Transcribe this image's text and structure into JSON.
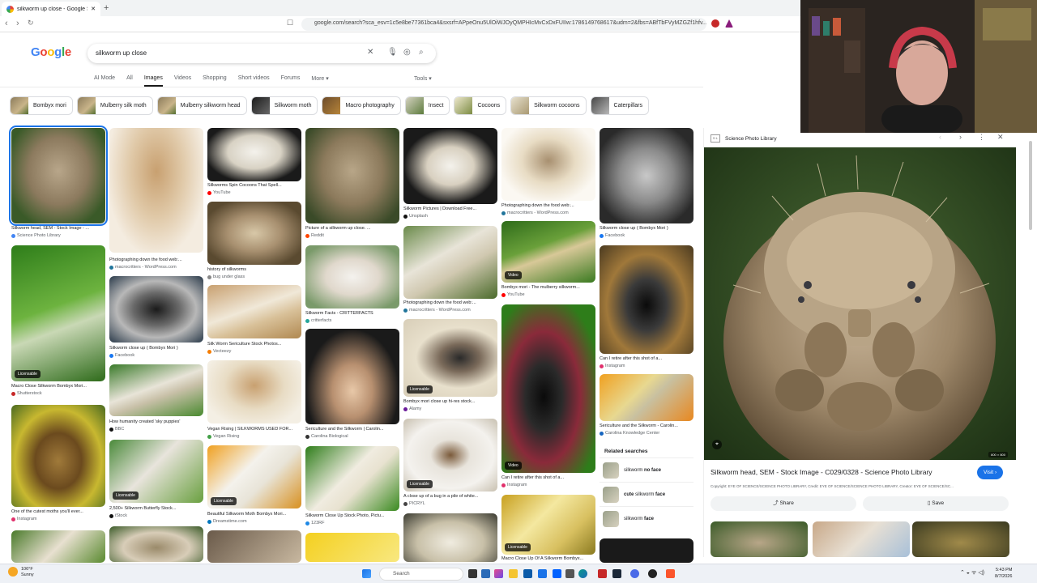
{
  "browser": {
    "tab_title": "silkworm up close - Google Sear",
    "url": "google.com/search?sca_esv=1c5e8be77361bca4&sxsrf=APpeOnu5UlOiWJOyQMPHIcMvCxDxFUIIw:1786149768617&udm=2&fbs=ABfTbFVyMZGZf1hfv..."
  },
  "google": {
    "logo": "Google",
    "query": "silkworm up close",
    "tabs": [
      "AI Mode",
      "All",
      "Images",
      "Videos",
      "Shopping",
      "Short videos",
      "Forums",
      "More ▾"
    ],
    "active_tab": "Images",
    "tools": "Tools ▾"
  },
  "chips": [
    "Bombyx mori",
    "Mulberry silk moth",
    "Mulberry silkworm head",
    "Silkworm moth",
    "Macro photography",
    "Insect",
    "Cocoons",
    "Silkworm cocoons",
    "Caterpillars"
  ],
  "results": [
    {
      "cap": "Silkworm head, SEM - Stock Image - ...",
      "src": "Science Photo Library"
    },
    {
      "cap": "Macro Close Silkworm Bombyx Mori...",
      "src": "Shutterstock",
      "badge": "Licensable"
    },
    {
      "cap": "One of the cutest moths you'll ever...",
      "src": "Instagram"
    },
    {
      "cap": "Photographing down the food web:...",
      "src": "macrocritters - WordPress.com"
    },
    {
      "cap": "Silkworm close up ( Bombyx Mori )",
      "src": "Facebook"
    },
    {
      "cap": "How humanity created 'sky puppies'",
      "src": "BBC"
    },
    {
      "cap": "2,500+ Silkworm Butterfly Stock...",
      "src": "iStock",
      "badge": "Licensable"
    },
    {
      "cap": "Silkworms Spin Cocoons That Spell...",
      "src": "YouTube"
    },
    {
      "cap": "history of silkworms",
      "src": "bug under glass"
    },
    {
      "cap": "Silk Worm Sericulture Stock Photos...",
      "src": "Vecteezy"
    },
    {
      "cap": "Vegan Rising | SILKWORMS USED FOR...",
      "src": "Vegan Rising"
    },
    {
      "cap": "Beautiful Silkworm Moth Bombyx Mori...",
      "src": "Dreamstime.com",
      "badge": "Licensable"
    },
    {
      "cap": "Picture of a silkworm up close. ...",
      "src": "Reddit"
    },
    {
      "cap": "Silkworm Facts - CRITTERFACTS",
      "src": "critterfacts"
    },
    {
      "cap": "Sericulture and the Silkworm | Carolin...",
      "src": "Carolina Biological"
    },
    {
      "cap": "Silkworm Close Up Stock Photo, Pictu...",
      "src": "123RF"
    },
    {
      "cap": "Silkworm Pictures | Download Free...",
      "src": "Unsplash"
    },
    {
      "cap": "Photographing down the food web:...",
      "src": "macrocritters - WordPress.com"
    },
    {
      "cap": "Bombyx mori close up hi-res stock...",
      "src": "Alamy",
      "badge": "Licensable"
    },
    {
      "cap": "A close up of a bug in a pile of white...",
      "src": "PICRYL",
      "badge": "Licensable"
    },
    {
      "cap": "Photographing down the food web:...",
      "src": "macrocritters - WordPress.com"
    },
    {
      "cap": "Bombyx mori - The mulberry silkworm...",
      "src": "YouTube",
      "badge": "Video"
    },
    {
      "cap": "Can I retire after this shot of a...",
      "src": "Instagram",
      "badge": "Video"
    },
    {
      "cap": "Macro Close Up Of A Silkworm Bombyx...",
      "src": "",
      "badge": "Licensable"
    },
    {
      "cap": "Silkworm close up ( Bombyx Mori )",
      "src": "Facebook"
    },
    {
      "cap": "Can I retire after this shot of a...",
      "src": "Instagram"
    },
    {
      "cap": "Sericulture and the Silkworm - Carolin...",
      "src": "Carolina Knowledge Center"
    }
  ],
  "related": {
    "heading": "Related searches",
    "items": [
      {
        "pre": "silkworm ",
        "bold": "no face"
      },
      {
        "pre": "",
        "bold": "cute ",
        "post": "silkworm ",
        "bold2": "face"
      },
      {
        "pre": "silkworm ",
        "bold": "face"
      }
    ]
  },
  "panel": {
    "source": "Science Photo Library",
    "title": "Silkworm head, SEM - Stock Image - C029/0328 - Science Photo Library",
    "visit": "Visit ›",
    "copyright": "Copyright: EYE OF SCIENCE/SCIENCE PHOTO LIBRARY, Credit: EYE OF SCIENCE/SCIENCE PHOTO LIBRARY, Creator: EYE OF SCIENCE/SC...",
    "share": "Share",
    "save": "Save",
    "dims": "800 × 800"
  },
  "taskbar": {
    "temp": "106°F",
    "weather": "Sunny",
    "search": "Search",
    "time": "5:43 PM",
    "date": "8/7/2026"
  },
  "colors": {
    "accent": "#1a73e8",
    "background": "#ffffff"
  }
}
